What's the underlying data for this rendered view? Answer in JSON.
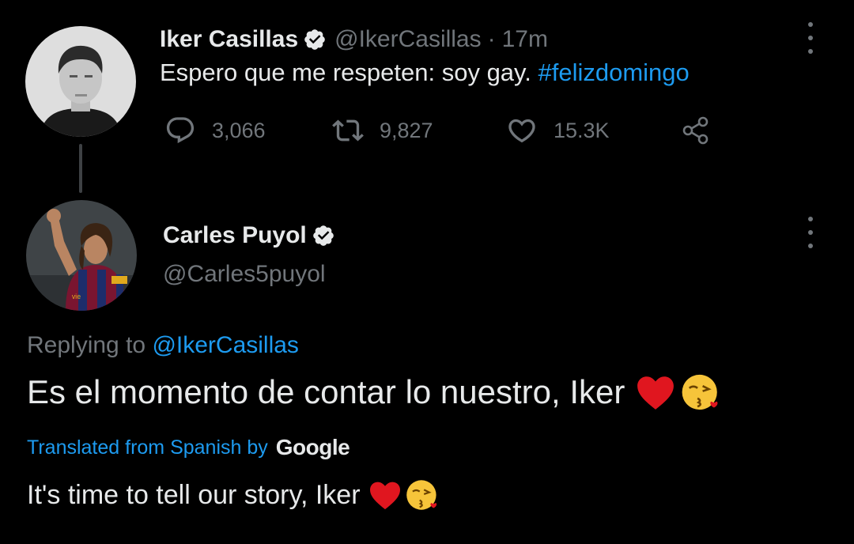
{
  "tweet": {
    "author_name": "Iker Casillas",
    "handle": "@IkerCasillas",
    "separator": "·",
    "time": "17m",
    "text_main": "Espero que me respeten: soy gay. ",
    "hashtag": "#felizdomingo",
    "actions": {
      "replies": "3,066",
      "retweets": "9,827",
      "likes": "15.3K"
    }
  },
  "reply": {
    "author_name": "Carles Puyol",
    "handle": "@Carles5puyol",
    "replying_prefix": "Replying to ",
    "replying_to": "@IkerCasillas",
    "text": "Es el momento de contar lo nuestro, Iker",
    "translated_label": "Translated from Spanish by",
    "translator": "Google",
    "translation": "It's time to tell our story, Iker"
  },
  "icons": {
    "verified": "verified-badge-icon",
    "reply": "reply-icon",
    "retweet": "retweet-icon",
    "like": "heart-icon",
    "share": "share-icon",
    "more": "more-vertical-icon"
  },
  "colors": {
    "background": "#000000",
    "text": "#e7e9ea",
    "muted": "#71767b",
    "link": "#1d9bf0"
  }
}
